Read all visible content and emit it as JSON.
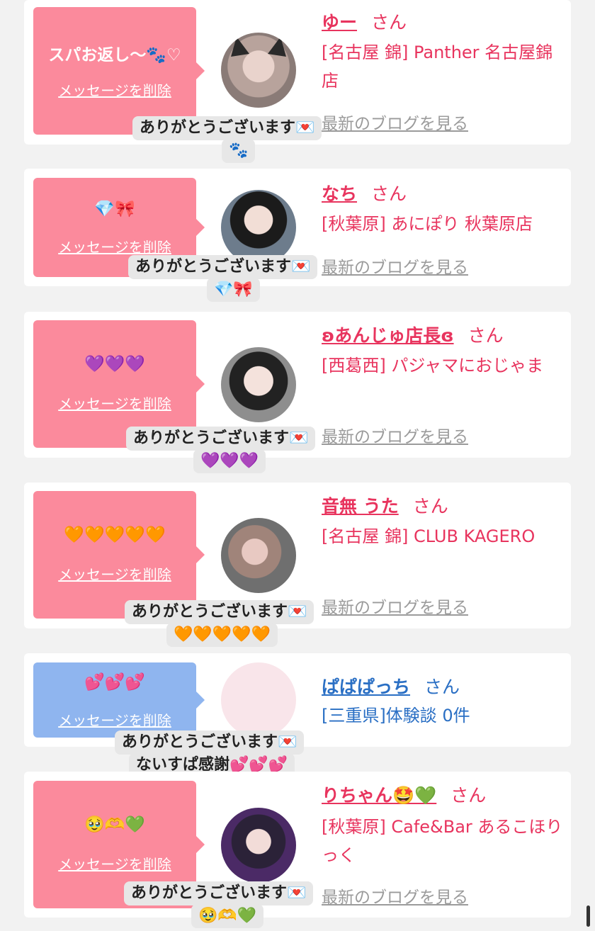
{
  "card1": {
    "bubble_msg": "スパお返し〜🐾♡",
    "delete_label": "メッセージを削除",
    "name": "ゆー",
    "san": "さん",
    "shop": "[名古屋 錦] Panther 名古屋錦店",
    "blog": "最新のブログを見る",
    "tip_line1": "ありがとうございます💌",
    "tip_line2": "🐾"
  },
  "card2": {
    "bubble_msg": "💎🎀",
    "delete_label": "メッセージを削除",
    "name": "なち",
    "san": "さん",
    "shop": "[秋葉原] あにぽり 秋葉原店",
    "blog": "最新のブログを見る",
    "tip_line1": "ありがとうございます💌",
    "tip_line2": "💎🎀"
  },
  "card3": {
    "bubble_msg": "💜💜💜",
    "delete_label": "メッセージを削除",
    "name": "ʚあんじゅ店長ɞ",
    "san": "さん",
    "shop": "[西葛西] パジャマにおじゃま",
    "blog": "最新のブログを見る",
    "tip_line1": "ありがとうございます💌",
    "tip_line2": "💜💜💜"
  },
  "card4": {
    "bubble_msg": "🧡🧡🧡🧡🧡",
    "delete_label": "メッセージを削除",
    "name": "音無 うた",
    "san": "さん",
    "shop": "[名古屋 錦] CLUB KAGERO",
    "blog": "最新のブログを見る",
    "tip_line1": "ありがとうございます💌",
    "tip_line2": "🧡🧡🧡🧡🧡"
  },
  "card5": {
    "bubble_msg": "💕💕💕",
    "delete_label": "メッセージを削除",
    "name": "ぱぱぱっち",
    "san": "さん",
    "shop": "[三重県]体験談 0件",
    "tip_line1": "ありがとうございます💌",
    "tip_line2": "ないすぱ感謝💕💕💕"
  },
  "card6": {
    "bubble_msg": "🥹🫶💚",
    "delete_label": "メッセージを削除",
    "name": "りちゃん🤩💚",
    "san": "さん",
    "shop": "[秋葉原] Cafe&Bar あるこほりっく",
    "blog": "最新のブログを見る",
    "tip_line1": "ありがとうございます💌",
    "tip_line2": "🥹🫶💚"
  },
  "colors": {
    "pink_bubble": "#fb8a9c",
    "blue_bubble": "#8fb5ef",
    "name_pink": "#e8345e",
    "name_blue": "#2a6fc4",
    "tooltip_bg": "#e7e7e7"
  }
}
